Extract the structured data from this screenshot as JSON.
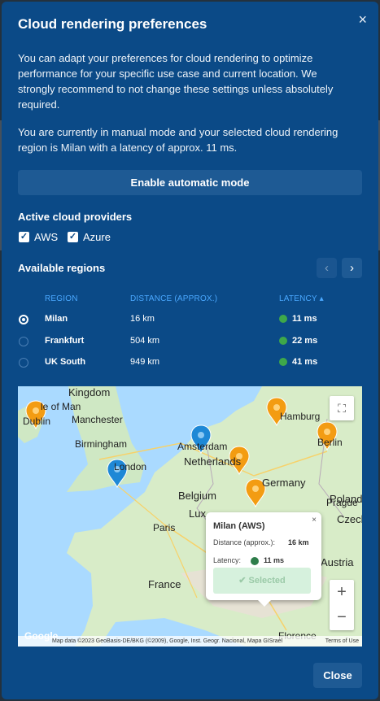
{
  "modal": {
    "title": "Cloud rendering preferences",
    "close_icon": "×",
    "intro": "You can adapt your preferences for cloud rendering to optimize performance for your specific use case and current location. We strongly recommend to not change these settings unless absolutely required.",
    "status": "You are currently in manual mode and your selected cloud rendering region is Milan with a latency of approx. 11 ms.",
    "auto_button": "Enable automatic mode",
    "close_button": "Close"
  },
  "providers": {
    "heading": "Active cloud providers",
    "items": [
      {
        "label": "AWS",
        "checked": true
      },
      {
        "label": "Azure",
        "checked": true
      }
    ]
  },
  "regions": {
    "heading": "Available regions",
    "prev_icon": "‹",
    "next_icon": "›",
    "columns": {
      "region": "REGION",
      "distance": "DISTANCE (APPROX.)",
      "latency": "LATENCY ▴"
    },
    "rows": [
      {
        "name": "Milan",
        "distance": "16 km",
        "latency": "11 ms",
        "selected": true
      },
      {
        "name": "Frankfurt",
        "distance": "504 km",
        "latency": "22 ms",
        "selected": false
      },
      {
        "name": "UK South",
        "distance": "949 km",
        "latency": "41 ms",
        "selected": false
      }
    ]
  },
  "map": {
    "labels": {
      "kingdom": "Kingdom",
      "isle": "le of Man",
      "dublin": "Dublin",
      "manchester": "Manchester",
      "birmingham": "Birmingham",
      "london": "London",
      "amsterdam": "Amsterdam",
      "netherlands": "Netherlands",
      "hamburg": "Hamburg",
      "berlin": "Berlin",
      "germany": "Germany",
      "poland": "Poland",
      "belgium": "Belgium",
      "luxembourg": "Lux",
      "paris": "Paris",
      "prague": "Prague",
      "czech": "Czech",
      "austria": "Austria",
      "france": "France",
      "florence": "Florence",
      "google": "Google"
    },
    "fullscreen_icon": "⛶",
    "zoom_in": "+",
    "zoom_out": "−",
    "attribution": "Map data ©2023 GeoBasis-DE/BKG (©2009), Google, Inst. Geogr. Nacional, Mapa GISrael",
    "terms": "Terms of Use",
    "popup": {
      "title": "Milan (AWS)",
      "close_icon": "×",
      "distance_label": "Distance (approx.):",
      "distance_value": "16 km",
      "latency_label": "Latency:",
      "latency_value": "11 ms",
      "button": "✔ Selected"
    }
  },
  "colors": {
    "modal_bg": "#0b4a87",
    "button_bg": "#1e5a94",
    "accent_blue": "#4aa8ff",
    "latency_good": "#3ea84a",
    "pin_orange": "#f39c12",
    "pin_blue": "#1e88d6"
  }
}
